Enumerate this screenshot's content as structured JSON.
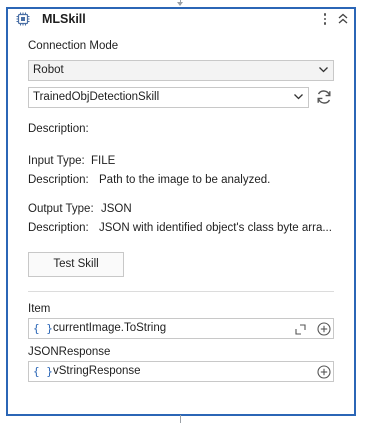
{
  "header": {
    "title": "MLSkill",
    "icon": "ml-skill-icon",
    "menu_icon": "kebab-menu-icon",
    "collapse_icon": "collapse-chevron-up-icon"
  },
  "connection": {
    "label": "Connection Mode",
    "selected": "Robot"
  },
  "skill": {
    "selected": "TrainedObjDetectionSkill",
    "refresh_icon": "refresh-icon"
  },
  "description": {
    "label": "Description:"
  },
  "input": {
    "type_label": "Input Type:",
    "type_value": "FILE",
    "desc_label": "Description:",
    "desc_value": "Path to the image to be analyzed."
  },
  "output": {
    "type_label": "Output Type:",
    "type_value": "JSON",
    "desc_label": "Description:",
    "desc_value": "JSON with identified object's class byte arra..."
  },
  "test_button": {
    "label": "Test Skill"
  },
  "item": {
    "label": "Item",
    "braces": "{ }",
    "value": "currentImage.ToString"
  },
  "json_response": {
    "label": "JSONResponse",
    "braces": "{ }",
    "value": "vStringResponse"
  },
  "colors": {
    "accent": "#2b66b6",
    "border": "#c8c8c8",
    "text": "#1f1f1f"
  }
}
